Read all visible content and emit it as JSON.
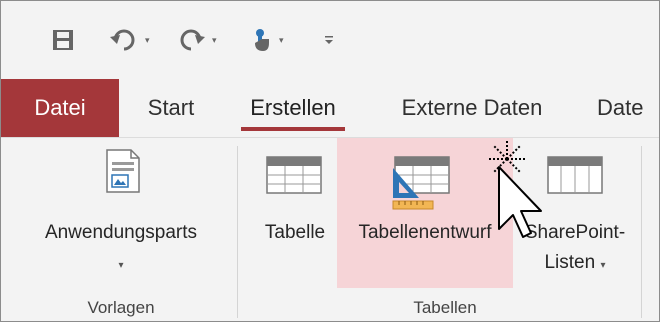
{
  "quick_access": {
    "save_icon": "save-icon",
    "undo_icon": "undo-icon",
    "redo_icon": "redo-icon",
    "touch_icon": "touch-mode-icon",
    "customize_icon": "customize-icon"
  },
  "tabs": [
    {
      "label": "Datei"
    },
    {
      "label": "Start"
    },
    {
      "label": "Erstellen"
    },
    {
      "label": "Externe Daten"
    },
    {
      "label": "Date"
    }
  ],
  "ribbon": {
    "vorlagen": {
      "group_label": "Vorlagen",
      "anwendungsparts_label": "Anwendungsparts",
      "anwendungsparts_caret": "▾"
    },
    "tabellen": {
      "group_label": "Tabellen",
      "tabelle_label": "Tabelle",
      "tabellenentwurf_label": "Tabellenentwurf",
      "sharepoint_label_1": "SharePoint-",
      "sharepoint_label_2": "Listen",
      "sharepoint_caret": "▾"
    }
  },
  "colors": {
    "accent": "#a4373a",
    "highlight": "#f6d4d7",
    "ribbon_bg": "#f3f3f3"
  }
}
